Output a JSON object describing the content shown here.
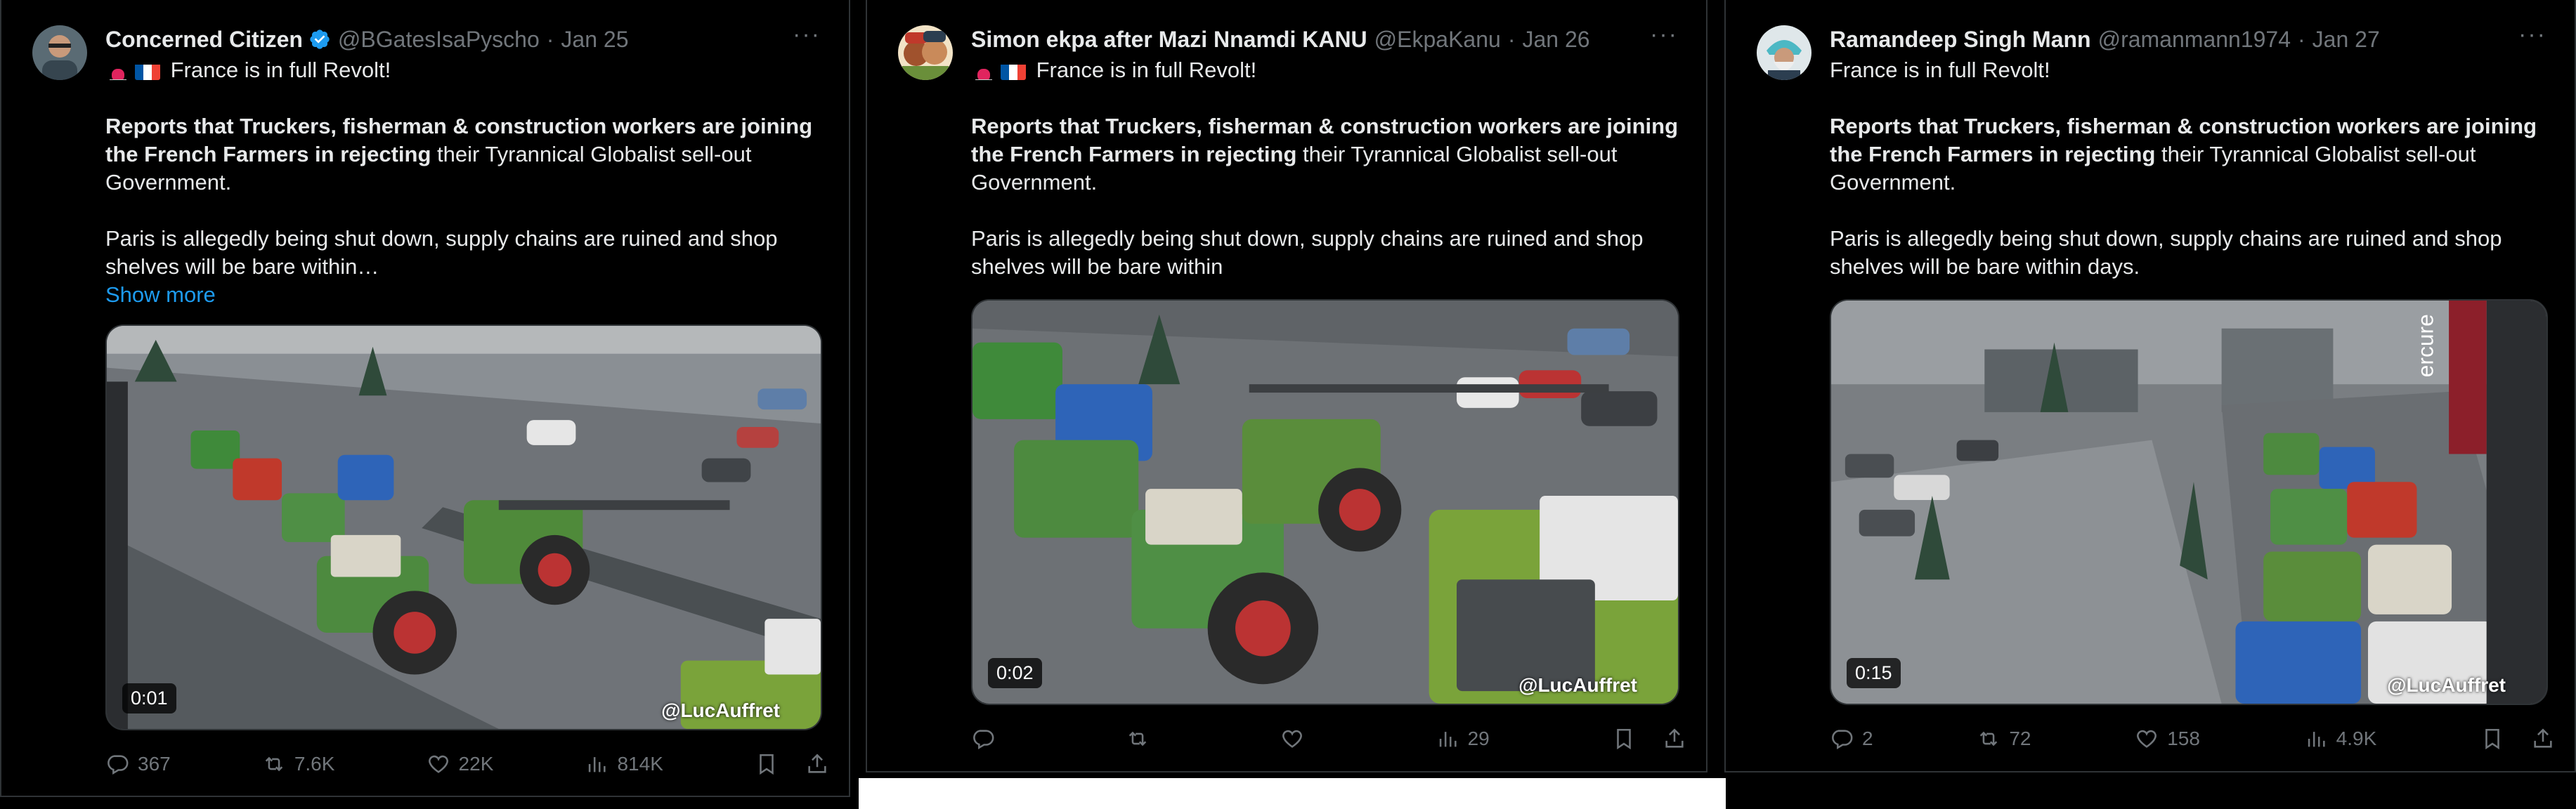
{
  "tweets": [
    {
      "author": "Concerned Citizen",
      "handle": "@BGatesIsaPyscho",
      "date": "Jan 25",
      "verified": true,
      "line1": "France is in full Revolt!",
      "bold": "Reports that Truckers, fisherman & construction workers are joining the French Farmers in rejecting",
      "rest": " their Tyrannical Globalist sell-out Government.",
      "para2": "Paris is allegedly being shut down, supply chains are ruined and shop shelves will be bare within…",
      "show_more": "Show more",
      "video_time": "0:01",
      "watermark": "@LucAuffret",
      "replies": "367",
      "reposts": "7.6K",
      "likes": "22K",
      "views": "814K"
    },
    {
      "author": "Simon ekpa after Mazi Nnamdi KANU",
      "handle": "@EkpaKanu",
      "date": "Jan 26",
      "verified": false,
      "line1": "France is in full Revolt!",
      "bold": "Reports that Truckers, fisherman & construction workers are joining the French Farmers in rejecting",
      "rest": " their Tyrannical Globalist sell-out Government.",
      "para2": "Paris is allegedly being shut down, supply chains are ruined and shop shelves will be bare within",
      "video_time": "0:02",
      "watermark": "@LucAuffret",
      "replies": "",
      "reposts": "",
      "likes": "",
      "views": "29"
    },
    {
      "author": "Ramandeep Singh Mann",
      "handle": "@ramanmann1974",
      "date": "Jan 27",
      "verified": false,
      "line1": "France is in full Revolt!",
      "bold": "Reports that Truckers, fisherman & construction workers are joining the French Farmers in rejecting",
      "rest": " their Tyrannical Globalist sell-out Government.",
      "para2": "Paris is allegedly being shut down, supply chains are ruined and shop shelves will be bare within days.",
      "video_time": "0:15",
      "watermark": "@LucAuffret",
      "store_sign": "ercure",
      "replies": "2",
      "reposts": "72",
      "likes": "158",
      "views": "4.9K"
    }
  ],
  "colors": {
    "background": "#000000",
    "text": "#e7e9ea",
    "muted": "#71767b",
    "accent": "#1d9bf0",
    "border": "#2f3336"
  },
  "icons": [
    "verified-badge-icon",
    "more-options-icon",
    "reply-icon",
    "repost-icon",
    "like-icon",
    "views-icon",
    "bookmark-icon",
    "share-icon",
    "siren-emoji-icon",
    "france-flag-icon"
  ]
}
